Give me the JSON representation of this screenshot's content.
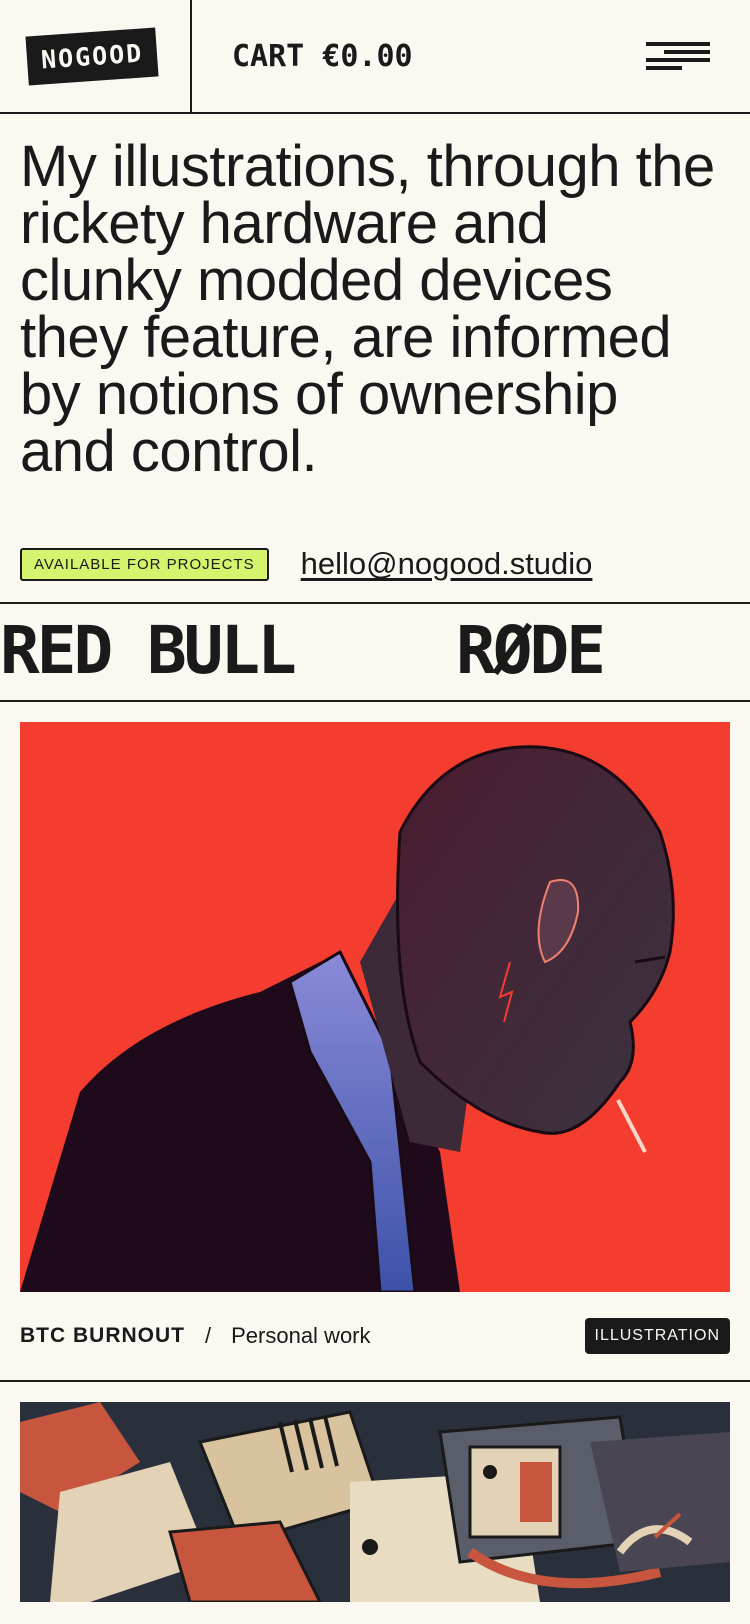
{
  "header": {
    "logo_text": "NOGOOD",
    "cart_label": "CART €0.00",
    "menu_icon": "menu-icon"
  },
  "hero": {
    "statement": "My illustrations, through the rickety hardware and clunky modded devices they feature, are informed by notions of ownership and control.",
    "availability_badge": "AVAILABLE FOR PROJECTS",
    "email": "hello@nogood.studio"
  },
  "clients": [
    "RED BULL",
    "RØDE"
  ],
  "projects": [
    {
      "title": "BTC BURNOUT",
      "separator": "/",
      "subtitle": "Personal work",
      "tag": "ILLUSTRATION"
    }
  ],
  "colors": {
    "background": "#faf8f1",
    "ink": "#1a1a1a",
    "badge": "#d6f36d",
    "art_red": "#f53d2f"
  }
}
